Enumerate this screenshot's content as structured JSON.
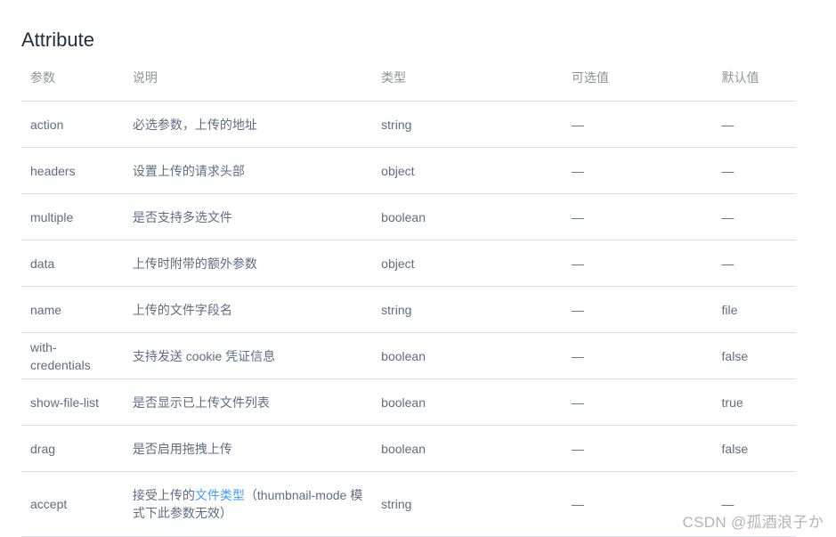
{
  "title": "Attribute",
  "columns": [
    "参数",
    "说明",
    "类型",
    "可选值",
    "默认值"
  ],
  "rows": [
    {
      "param": "action",
      "desc": "必选参数，上传的地址",
      "type": "string",
      "options": "—",
      "default": "—"
    },
    {
      "param": "headers",
      "desc": "设置上传的请求头部",
      "type": "object",
      "options": "—",
      "default": "—"
    },
    {
      "param": "multiple",
      "desc": "是否支持多选文件",
      "type": "boolean",
      "options": "—",
      "default": "—"
    },
    {
      "param": "data",
      "desc": "上传时附带的额外参数",
      "type": "object",
      "options": "—",
      "default": "—"
    },
    {
      "param": "name",
      "desc": "上传的文件字段名",
      "type": "string",
      "options": "—",
      "default": "file"
    },
    {
      "param": "with-credentials",
      "desc": "支持发送 cookie 凭证信息",
      "type": "boolean",
      "options": "—",
      "default": "false"
    },
    {
      "param": "show-file-list",
      "desc": "是否显示已上传文件列表",
      "type": "boolean",
      "options": "—",
      "default": "true"
    },
    {
      "param": "drag",
      "desc": "是否启用拖拽上传",
      "type": "boolean",
      "options": "—",
      "default": "false"
    },
    {
      "param": "accept",
      "desc_before": "接受上传的",
      "desc_link": "文件类型",
      "desc_after": "（thumbnail-mode 模式下此参数无效）",
      "type": "string",
      "options": "—",
      "default": "—"
    }
  ],
  "watermark": "CSDN @孤酒浪子か"
}
